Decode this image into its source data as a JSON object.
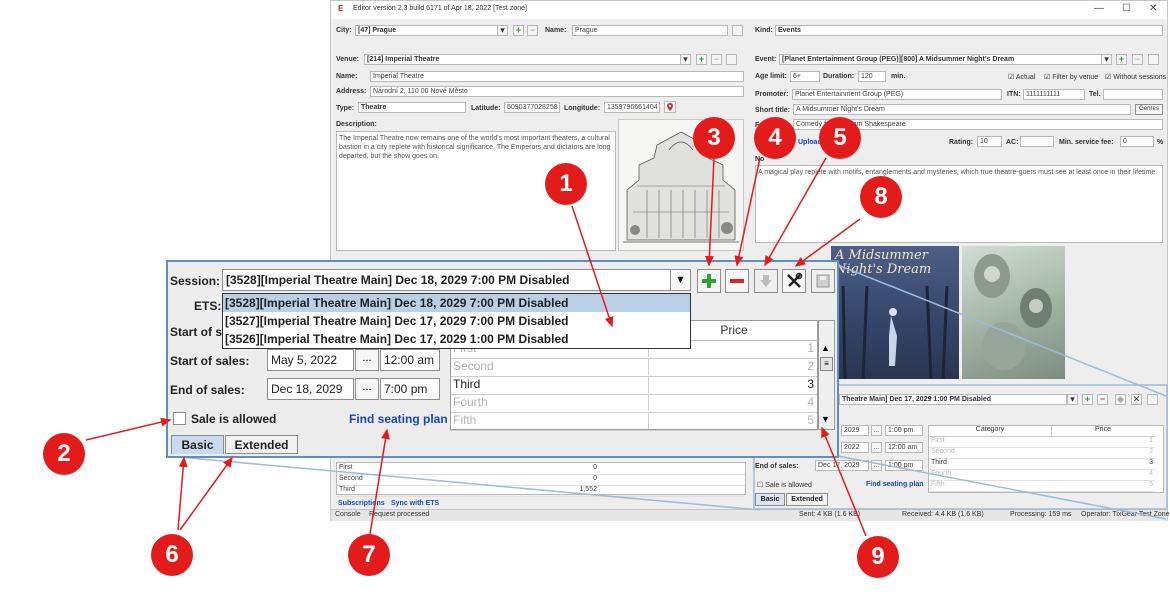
{
  "app": {
    "title": "Editor version 2.3 build 6171 of Apr 18, 2022 [Test zone]",
    "logo": "E",
    "window_controls": [
      "—",
      "☐",
      "✕"
    ]
  },
  "left_form": {
    "city_label": "City:",
    "city_value": "[47] Prague",
    "name_label": "Name:",
    "name_value": "Prague",
    "venue_label": "Venue:",
    "venue_value": "[214] Imperial Theatre",
    "venue_name_label": "Name:",
    "venue_name_value": "Imperial Theatre",
    "address_label": "Address:",
    "address_value": "Národní 2, 110 00 Nové Město",
    "type_label": "Type:",
    "type_value": "Theatre",
    "latitude_label": "Latitude:",
    "latitude_value": "5090377028258",
    "longitude_label": "Longitude:",
    "longitude_value": "1359796661404",
    "description_label": "Description:",
    "description_value": "The Imperial Theatre now remains one of the world's most important theaters, a cultural bastion in a city replete with historical significance. The Emperors and dictators are long departed, but the show goes on."
  },
  "right_form": {
    "kind_label": "Kind:",
    "kind_value": "Events",
    "event_label": "Event:",
    "event_value": "[Planet Entertainment Group (PEG)][800] A Midsummer Night's Dream",
    "age_label": "Age limit:",
    "age_value": "6+",
    "duration_label": "Duration:",
    "duration_value": "120",
    "duration_unit": "min.",
    "actual_label": "Actual",
    "filter_label": "Filter by venue",
    "without_label": "Without sessions",
    "promoter_label": "Promoter:",
    "promoter_value": "Planet Entertainment Group (PEG)",
    "itn_label": "ITN:",
    "itn_value": "1111111111",
    "tel_label": "Tel.",
    "short_title_label": "Short title:",
    "short_title_value": "A Midsummer Night's Dream",
    "genres_button": "Genres",
    "full_label": "Full",
    "full_value": "Comedy from William Shakespeare",
    "upload_label": "Upload",
    "rating_label": "Rating:",
    "rating_value": "10",
    "ac_label": "AC:",
    "min_fee_label": "Min. service fee:",
    "min_fee_value": "0",
    "percent": "%",
    "note_label": "No",
    "event_description": "A magical play replete with motifs, entanglements and mysteries, which true theatre-goers must see at least once in their lifetime.",
    "poster_text": "A Midsummer Night's Dream"
  },
  "bg_session": {
    "session_value": "Theatre Main] Dec 17, 2029 1:00 PM Disabled",
    "date1": "2029",
    "time1": "1:00 pm",
    "date2": "2022",
    "time2": "12:00 am",
    "end_label": "End of sales:",
    "end_date": "Dec 17, 2029",
    "end_time": "1:00 pm",
    "sale_label": "Sale is allowed",
    "find_plan": "Find seating plan",
    "tab_basic": "Basic",
    "tab_extended": "Extended",
    "col_category": "Category",
    "col_price": "Price",
    "rows": [
      {
        "category": "First",
        "price": "1"
      },
      {
        "category": "Second",
        "price": "2"
      },
      {
        "category": "Third",
        "price": "3"
      },
      {
        "category": "Fourth",
        "price": "4"
      },
      {
        "category": "Fifth",
        "price": "5"
      }
    ]
  },
  "bg_left_table": {
    "rows": [
      {
        "name": "First",
        "value": "0"
      },
      {
        "name": "Second",
        "value": "0"
      },
      {
        "name": "Third",
        "value": "1,552"
      }
    ],
    "subscriptions": "Subscriptions",
    "sync_ets": "Sync with ETS"
  },
  "status_bar": {
    "console": "Console",
    "request": "Request processed",
    "sent": "Sent: 4 KB (1.6 KB)",
    "received": "Received: 4.4 KB (1.6 KB)",
    "processing": "Processing: 159 ms",
    "operator": "Operator: TixGear Test Zone"
  },
  "panel": {
    "session_label": "Session:",
    "session_value": "[3528][Imperial Theatre Main] Dec 18, 2029 7:00 PM Disabled",
    "dropdown_options": [
      "[3528][Imperial Theatre Main] Dec 18, 2029 7:00 PM Disabled",
      "[3527][Imperial Theatre Main] Dec 17, 2029 7:00 PM Disabled",
      "[3526][Imperial Theatre Main] Dec 17, 2029 1:00 PM Disabled"
    ],
    "ets_label": "ETS:",
    "start_session_label": "Start of se",
    "start_sales_label": "Start of sales:",
    "start_sales_date": "May 5, 2022",
    "start_sales_time": "12:00 am",
    "end_sales_label": "End of sales:",
    "end_sales_date": "Dec 18, 2029",
    "end_sales_time": "7:00 pm",
    "dots": "...",
    "sale_allowed_label": "Sale is allowed",
    "find_seating_plan": "Find seating plan",
    "tab_basic": "Basic",
    "tab_extended": "Extended",
    "price_header": "Price",
    "grid_rows": [
      {
        "category": "First",
        "price": "1"
      },
      {
        "category": "Second",
        "price": "2"
      },
      {
        "category": "Third",
        "price": "3"
      },
      {
        "category": "Fourth",
        "price": "4"
      },
      {
        "category": "Fifth",
        "price": "5"
      }
    ]
  },
  "callouts": [
    "1",
    "2",
    "3",
    "4",
    "5",
    "6",
    "7",
    "8",
    "9"
  ],
  "colors": {
    "callout": "#e41b1b",
    "accent_border": "#5b8fc5",
    "selection": "#b9cfe6",
    "link": "#1746c7"
  }
}
